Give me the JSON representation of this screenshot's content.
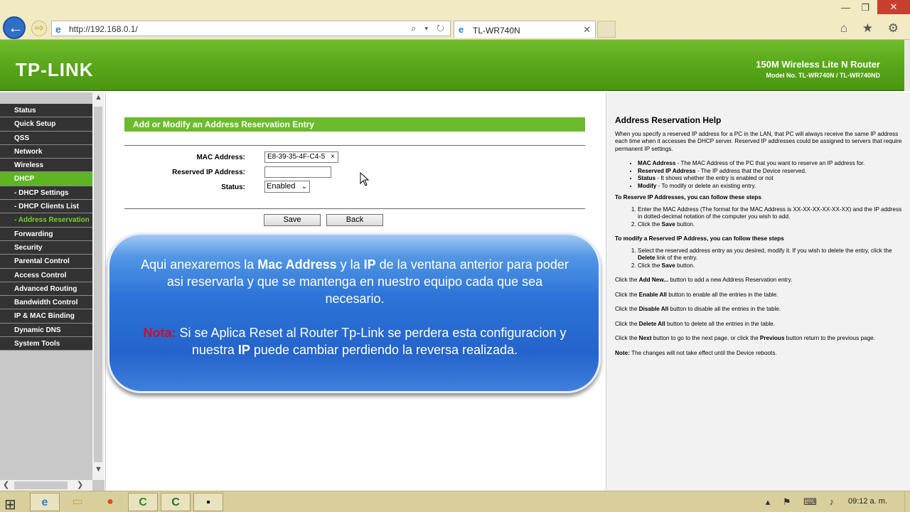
{
  "browser": {
    "url": "http://192.168.0.1/",
    "tab_title": "TL-WR740N",
    "ie_glyph": "e",
    "back_glyph": "←",
    "fwd_glyph": "⇨",
    "address_tools": "⌕ ▾ ↻",
    "tab_close": "✕",
    "minimize": "—",
    "maximize": "❐",
    "close": "✕",
    "right_icons": "⌂ ★ ⚙"
  },
  "header": {
    "logo": "TP-LINK",
    "model_title": "150M Wireless Lite N Router",
    "model_no": "Model No. TL-WR740N / TL-WR740ND"
  },
  "sidebar": {
    "items": [
      {
        "label": "Status"
      },
      {
        "label": "Quick Setup"
      },
      {
        "label": "QSS"
      },
      {
        "label": "Network"
      },
      {
        "label": "Wireless"
      },
      {
        "label": "DHCP"
      },
      {
        "label": "- DHCP Settings"
      },
      {
        "label": "- DHCP Clients List"
      },
      {
        "label": "- Address Reservation"
      },
      {
        "label": "Forwarding"
      },
      {
        "label": "Security"
      },
      {
        "label": "Parental Control"
      },
      {
        "label": "Access Control"
      },
      {
        "label": "Advanced Routing"
      },
      {
        "label": "Bandwidth Control"
      },
      {
        "label": "IP & MAC Binding"
      },
      {
        "label": "Dynamic DNS"
      },
      {
        "label": "System Tools"
      }
    ],
    "scroll_up": "▲",
    "scroll_down": "▼",
    "scroll_left": "❮",
    "scroll_right": "❯"
  },
  "form": {
    "title": "Add or Modify an Address Reservation Entry",
    "mac_label": "MAC Address:",
    "mac_value": "E8-39-35-4F-C4-5",
    "clear_glyph": "×",
    "ip_label": "Reserved IP Address:",
    "ip_value": "",
    "status_label": "Status:",
    "status_value": "Enabled",
    "select_arrow": "⌄",
    "save_label": "Save",
    "back_label": "Back"
  },
  "overlay": {
    "p1_a": "Aqui anexaremos la ",
    "p1_b": "Mac Address",
    "p1_c": " y la ",
    "p1_d": "IP",
    "p1_e": " de la ventana anterior para poder asi reservarla y que se mantenga en nuestro equipo cada que sea necesario.",
    "nota": "Nota:",
    "p2_a": " Si se Aplica Reset al Router Tp-Link se perdera esta configuracion y nuestra ",
    "p2_b": "IP",
    "p2_c": " puede cambiar perdiendo la reversa realizada."
  },
  "help": {
    "title": "Address Reservation Help",
    "intro": "When you specify a reserved IP address for a PC in the LAN, that PC will always receive the same IP address each time when it accesses the DHCP server. Reserved IP addresses could be assigned to servers that require permanent IP settings.",
    "bullets": [
      {
        "term": "MAC Address",
        "text": " - The MAC Address of the PC that you want to reserve an IP address for."
      },
      {
        "term": "Reserved IP Address",
        "text": " - The IP address that the Device reserved."
      },
      {
        "term": "Status",
        "text": " - It shows whether the entry is enabled or not"
      },
      {
        "term": "Modify",
        "text": " - To modify or delete an existing entry."
      }
    ],
    "reserve_heading": "To Reserve IP Addresses, you can follow these steps",
    "reserve_step1": "Enter the MAC Address (The format for the MAC Address is XX-XX-XX-XX-XX-XX) and the IP address in dotted-decimal notation of the computer you wish to add.",
    "reserve_step2_a": "Click the ",
    "reserve_step2_b": "Save",
    "reserve_step2_c": " button.",
    "modify_heading": "To modify a Reserved IP Address, you can follow these steps",
    "modify_step1_a": "Select the reserved address entry as you desired, modify it. If you wish to delete the entry, click the ",
    "modify_step1_b": "Delete",
    "modify_step1_c": " link of the entry.",
    "modify_step2_a": "Click the ",
    "modify_step2_b": "Save",
    "modify_step2_c": " button.",
    "add_a": "Click the ",
    "add_b": "Add New...",
    "add_c": " button to add a new Address Reservation entry.",
    "enable_a": "Click the ",
    "enable_b": "Enable All",
    "enable_c": " button to enable all the entries in the table.",
    "disable_a": "Click the ",
    "disable_b": "Disable All",
    "disable_c": " button to disable all the entries in the table.",
    "delete_a": "Click the ",
    "delete_b": "Delete All",
    "delete_c": " button to delete all the entries in the table.",
    "next_a": "Click the ",
    "next_b": "Next",
    "next_c": " button to go to the next page, or click the ",
    "next_d": "Previous",
    "next_e": " button return to the previous page.",
    "note_a": "Note:",
    "note_b": " The changes will not take effect until the Device reboots."
  },
  "taskbar": {
    "start_glyph": "⊞",
    "apps": [
      {
        "name": "ie-icon",
        "glyph": "e"
      },
      {
        "name": "explorer-icon",
        "glyph": "▭"
      },
      {
        "name": "firefox-icon",
        "glyph": "●"
      },
      {
        "name": "camtasia-icon",
        "glyph": "C"
      },
      {
        "name": "camtasia-recorder-icon",
        "glyph": "C"
      },
      {
        "name": "cmd-icon",
        "glyph": "▪"
      }
    ],
    "tray": "▴ ⚑ ⌨ ♪",
    "clock": "09:12 a. m."
  }
}
